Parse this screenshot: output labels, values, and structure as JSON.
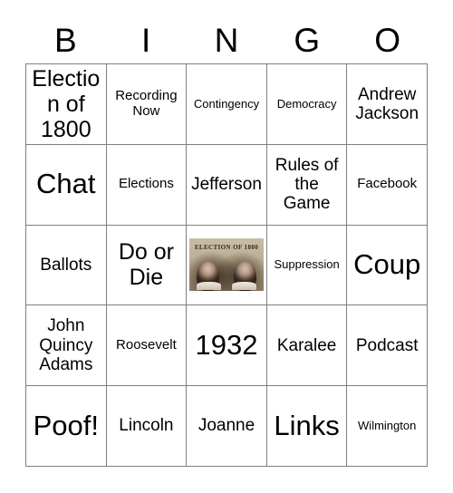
{
  "card": {
    "header_letters": [
      "B",
      "I",
      "N",
      "G",
      "O"
    ],
    "grid_line_color": "#7f7f7f",
    "text_color": "#000000",
    "background_color": "#ffffff",
    "rows": [
      [
        {
          "text": "Election of 1800",
          "size": "lg",
          "type": "text"
        },
        {
          "text": "Recording Now",
          "size": "sm",
          "type": "text"
        },
        {
          "text": "Contingency",
          "size": "xs",
          "type": "text"
        },
        {
          "text": "Democracy",
          "size": "xs",
          "type": "text"
        },
        {
          "text": "Andrew Jackson",
          "size": "md",
          "type": "text"
        }
      ],
      [
        {
          "text": "Chat",
          "size": "xl",
          "type": "text"
        },
        {
          "text": "Elections",
          "size": "sm",
          "type": "text"
        },
        {
          "text": "Jefferson",
          "size": "md",
          "type": "text"
        },
        {
          "text": "Rules of the Game",
          "size": "md",
          "type": "text"
        },
        {
          "text": "Facebook",
          "size": "sm",
          "type": "text"
        }
      ],
      [
        {
          "text": "Ballots",
          "size": "md",
          "type": "text"
        },
        {
          "text": "Do or Die",
          "size": "lg",
          "type": "text"
        },
        {
          "text": "",
          "size": "xs",
          "type": "image",
          "image_caption": "ELECTION OF 1800",
          "image_alt": "Election of 1800 portrait of John Adams and Thomas Jefferson"
        },
        {
          "text": "Suppression",
          "size": "xs",
          "type": "text"
        },
        {
          "text": "Coup",
          "size": "xl",
          "type": "text"
        }
      ],
      [
        {
          "text": "John Quincy Adams",
          "size": "md",
          "type": "text"
        },
        {
          "text": "Roosevelt",
          "size": "sm",
          "type": "text"
        },
        {
          "text": "1932",
          "size": "xl",
          "type": "text"
        },
        {
          "text": "Karalee",
          "size": "md",
          "type": "text"
        },
        {
          "text": "Podcast",
          "size": "md",
          "type": "text"
        }
      ],
      [
        {
          "text": "Poof!",
          "size": "xl",
          "type": "text"
        },
        {
          "text": "Lincoln",
          "size": "md",
          "type": "text"
        },
        {
          "text": "Joanne",
          "size": "md",
          "type": "text"
        },
        {
          "text": "Links",
          "size": "xl",
          "type": "text"
        },
        {
          "text": "Wilmington",
          "size": "xs",
          "type": "text"
        }
      ]
    ]
  }
}
